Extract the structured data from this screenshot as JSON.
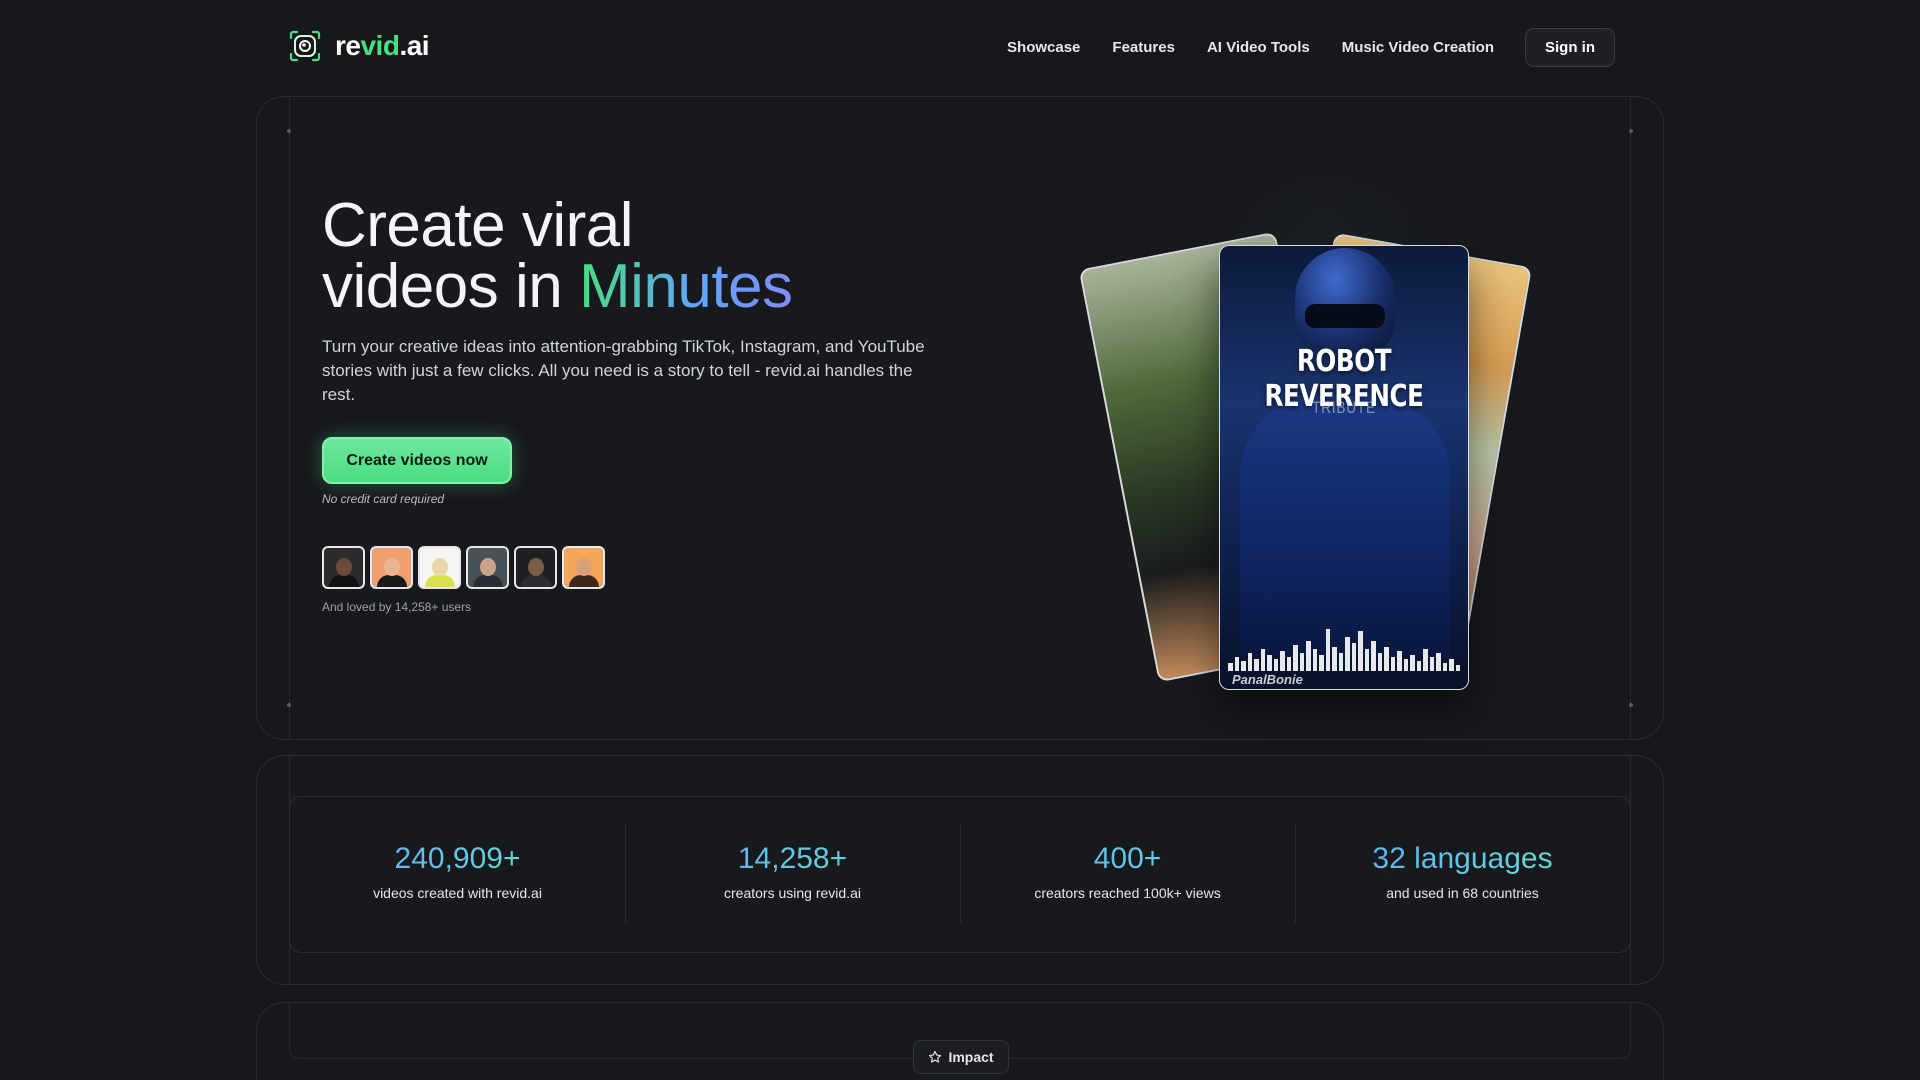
{
  "header": {
    "logo": {
      "prefix": "re",
      "highlight": "vid",
      "suffix": ".ai"
    },
    "nav": [
      "Showcase",
      "Features",
      "AI Video Tools",
      "Music Video Creation"
    ],
    "signin_label": "Sign in"
  },
  "hero": {
    "title_line1": "Create viral",
    "title_line2_prefix": "videos in ",
    "title_line2_highlight": "Minutes",
    "subtitle": "Turn your creative ideas into attention-grabbing TikTok, Instagram, and YouTube stories with just a few clicks. All you need is a story to tell - revid.ai handles the rest.",
    "cta_label": "Create videos now",
    "cta_note": "No credit card required",
    "loved_text": "And loved by 14,258+ users",
    "avatars": [
      {
        "bg": "#2b2b2b",
        "skin": "#6b4a3a",
        "shirt": "#111111"
      },
      {
        "bg": "#f0a070",
        "skin": "#e8b590",
        "shirt": "#1b1b1b"
      },
      {
        "bg": "#f6f6f0",
        "skin": "#e9d6a6",
        "shirt": "#d8e04a"
      },
      {
        "bg": "#4a5058",
        "skin": "#c9a38a",
        "shirt": "#2a2f36"
      },
      {
        "bg": "#1e2024",
        "skin": "#7a5b48",
        "shirt": "#2b2d31"
      },
      {
        "bg": "#f4a55a",
        "skin": "#d9a07a",
        "shirt": "#3a2a1e"
      }
    ],
    "featured_card": {
      "title": "ROBOT REVERENCE",
      "subtitle": "TRIBUTE",
      "brand": "PanalBonie"
    }
  },
  "stats": [
    {
      "value": "240,909+",
      "label": "videos created with revid.ai"
    },
    {
      "value": "14,258+",
      "label": "creators using revid.ai"
    },
    {
      "value": "400+",
      "label": "creators reached 100k+ views"
    },
    {
      "value": "32 languages",
      "label": "and used in 68 countries"
    }
  ],
  "impact": {
    "badge_label": "Impact",
    "icon": "star-icon"
  },
  "colors": {
    "accent_green": "#4ade80",
    "accent_blue": "#60a5fa",
    "bg": "#16181c"
  }
}
